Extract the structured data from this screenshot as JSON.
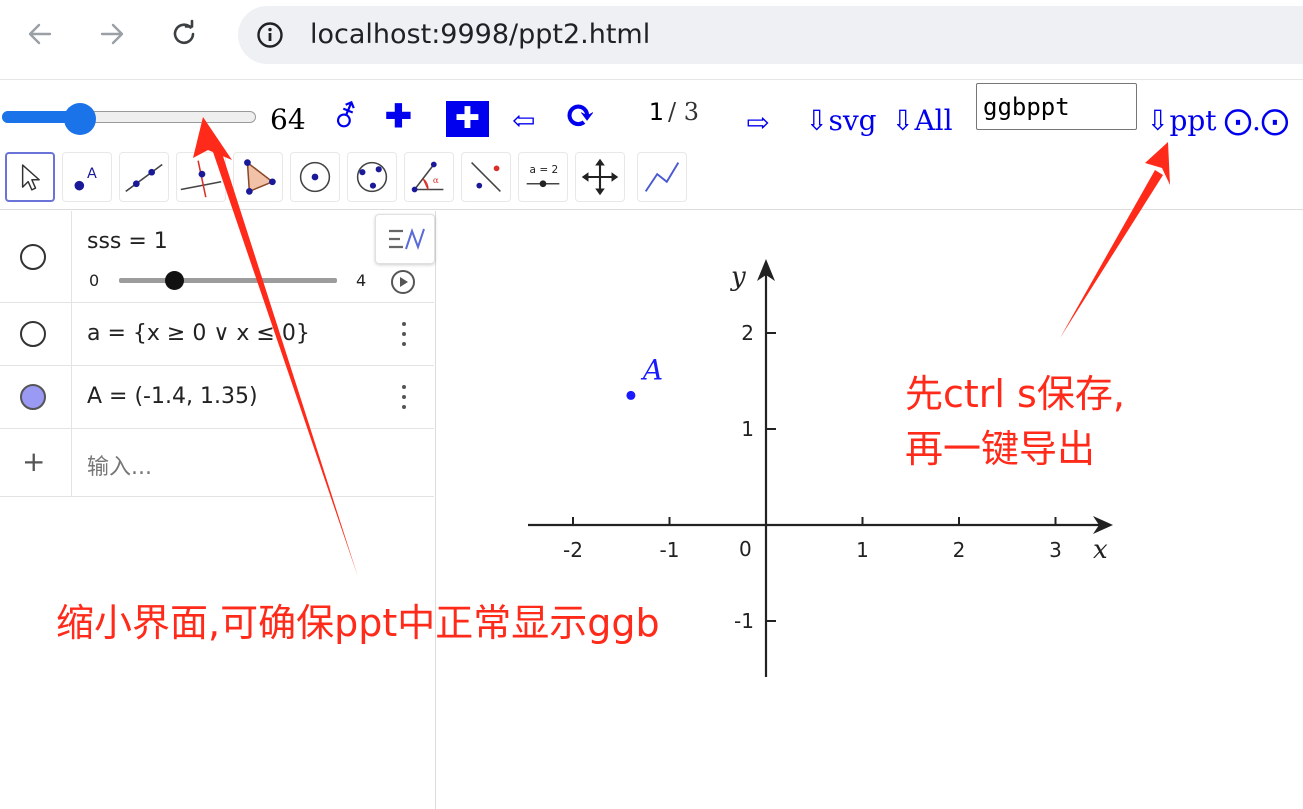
{
  "browser": {
    "url": "localhost:9998/ppt2.html"
  },
  "topbar": {
    "zoom_value": "64",
    "zoom_fraction": 0.25,
    "gender_glyph": "⚦",
    "plus_glyph": "✚",
    "plus_boxed_glyph": "✚",
    "prev_glyph": "⇦",
    "refresh_glyph": "⟳",
    "page_current": "1",
    "page_total": "/ 3",
    "next_glyph": "⇨",
    "export_svg": "⇩svg",
    "export_all": "⇩All",
    "name_value": "ggbppt",
    "export_ppt": "⇩ppt",
    "dots_glyph": "⨀.⨀"
  },
  "tools": [
    {
      "name": "move"
    },
    {
      "name": "point"
    },
    {
      "name": "line"
    },
    {
      "name": "perpendicular"
    },
    {
      "name": "polygon"
    },
    {
      "name": "circle-center-point"
    },
    {
      "name": "circle-three-points"
    },
    {
      "name": "angle"
    },
    {
      "name": "reflect"
    },
    {
      "name": "slider",
      "label": "a = 2"
    },
    {
      "name": "move-graphics-view"
    },
    {
      "name": "function"
    }
  ],
  "algebra": {
    "rows": [
      {
        "text": "sss = 1",
        "slider_min": "0",
        "slider_max": "4",
        "slider_fraction": 0.25
      },
      {
        "text": "a = {x ≥ 0 ∨ x ≤ 0}"
      },
      {
        "text": "A = (-1.4, 1.35)"
      }
    ],
    "input_placeholder": "输入...",
    "add_glyph": "+",
    "point_color": "#9a9af5"
  },
  "graph": {
    "x_axis_label": "x",
    "y_axis_label": "y",
    "origin_label": "0",
    "x_ticks": [
      {
        "value": -2,
        "label": "-2"
      },
      {
        "value": -1,
        "label": "-1"
      },
      {
        "value": 1,
        "label": "1"
      },
      {
        "value": 2,
        "label": "2"
      },
      {
        "value": 3,
        "label": "3"
      }
    ],
    "y_ticks": [
      {
        "value": 2,
        "label": "2"
      },
      {
        "value": 1,
        "label": "1"
      },
      {
        "value": -1,
        "label": "-1"
      }
    ],
    "point": {
      "label": "A",
      "x": -1.4,
      "y": 1.35,
      "color": "#1a1aff"
    }
  },
  "annotations": {
    "left": "缩小界面,可确保ppt中正常显示ggb",
    "right_line1": "先ctrl s保存,",
    "right_line2": "再一键导出",
    "color": "#ff2a1a"
  }
}
